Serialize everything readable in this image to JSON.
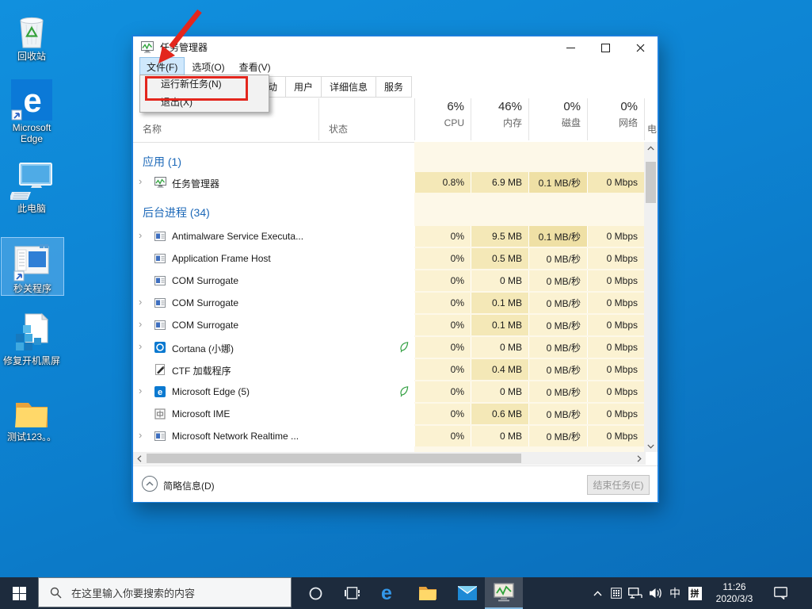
{
  "desktop": {
    "icons": [
      {
        "label": "回收站",
        "kind": "recycle-bin",
        "selected": false
      },
      {
        "label": "Microsoft Edge",
        "kind": "edge-shortcut",
        "selected": false
      },
      {
        "label": "此电脑",
        "kind": "this-pc",
        "selected": false
      },
      {
        "label": "秒关程序",
        "kind": "app-shortcut",
        "selected": true
      },
      {
        "label": "修复开机黑屏",
        "kind": "registry-file",
        "selected": false
      },
      {
        "label": "测试123。。",
        "kind": "folder",
        "selected": false
      }
    ]
  },
  "taskmgr": {
    "title": "任务管理器",
    "menubar": [
      "文件(F)",
      "选项(O)",
      "查看(V)"
    ],
    "file_menu": [
      "运行新任务(N)",
      "退出(X)"
    ],
    "tabs": [
      "启动",
      "用户",
      "详细信息",
      "服务"
    ],
    "columns": {
      "name": "名称",
      "status": "状态",
      "cpu": {
        "pct": "6%",
        "label": "CPU"
      },
      "mem": {
        "pct": "46%",
        "label": "内存"
      },
      "disk": {
        "pct": "0%",
        "label": "磁盘"
      },
      "net": {
        "pct": "0%",
        "label": "网络"
      },
      "partial": "电"
    },
    "rows": [
      {
        "type": "group",
        "label": "应用 (1)"
      },
      {
        "type": "proc",
        "name": "任务管理器",
        "icon": "taskmgr",
        "arrow": true,
        "leaf": false,
        "cpu": "0.8%",
        "mem": "6.9 MB",
        "disk": "0.1 MB/秒",
        "net": "0 Mbps",
        "heat": [
          2,
          2,
          3,
          2
        ]
      },
      {
        "type": "group",
        "label": "后台进程 (34)"
      },
      {
        "type": "proc",
        "name": "Antimalware Service Executa...",
        "icon": "app",
        "arrow": true,
        "leaf": false,
        "cpu": "0%",
        "mem": "9.5 MB",
        "disk": "0.1 MB/秒",
        "net": "0 Mbps",
        "heat": [
          1,
          2,
          3,
          1
        ]
      },
      {
        "type": "proc",
        "name": "Application Frame Host",
        "icon": "app",
        "arrow": false,
        "leaf": false,
        "cpu": "0%",
        "mem": "0.5 MB",
        "disk": "0 MB/秒",
        "net": "0 Mbps",
        "heat": [
          1,
          2,
          1,
          1
        ]
      },
      {
        "type": "proc",
        "name": "COM Surrogate",
        "icon": "app",
        "arrow": false,
        "leaf": false,
        "cpu": "0%",
        "mem": "0 MB",
        "disk": "0 MB/秒",
        "net": "0 Mbps",
        "heat": [
          1,
          1,
          1,
          1
        ]
      },
      {
        "type": "proc",
        "name": "COM Surrogate",
        "icon": "app",
        "arrow": true,
        "leaf": false,
        "cpu": "0%",
        "mem": "0.1 MB",
        "disk": "0 MB/秒",
        "net": "0 Mbps",
        "heat": [
          1,
          2,
          1,
          1
        ]
      },
      {
        "type": "proc",
        "name": "COM Surrogate",
        "icon": "app",
        "arrow": true,
        "leaf": false,
        "cpu": "0%",
        "mem": "0.1 MB",
        "disk": "0 MB/秒",
        "net": "0 Mbps",
        "heat": [
          1,
          2,
          1,
          1
        ]
      },
      {
        "type": "proc",
        "name": "Cortana (小娜)",
        "icon": "cortana",
        "arrow": true,
        "leaf": true,
        "cpu": "0%",
        "mem": "0 MB",
        "disk": "0 MB/秒",
        "net": "0 Mbps",
        "heat": [
          1,
          1,
          1,
          1
        ]
      },
      {
        "type": "proc",
        "name": "CTF 加载程序",
        "icon": "ctf",
        "arrow": false,
        "leaf": false,
        "cpu": "0%",
        "mem": "0.4 MB",
        "disk": "0 MB/秒",
        "net": "0 Mbps",
        "heat": [
          1,
          2,
          1,
          1
        ]
      },
      {
        "type": "proc",
        "name": "Microsoft Edge (5)",
        "icon": "edge",
        "arrow": true,
        "leaf": true,
        "cpu": "0%",
        "mem": "0 MB",
        "disk": "0 MB/秒",
        "net": "0 Mbps",
        "heat": [
          1,
          1,
          1,
          1
        ]
      },
      {
        "type": "proc",
        "name": "Microsoft IME",
        "icon": "ime",
        "arrow": false,
        "leaf": false,
        "cpu": "0%",
        "mem": "0.6 MB",
        "disk": "0 MB/秒",
        "net": "0 Mbps",
        "heat": [
          1,
          2,
          1,
          1
        ]
      },
      {
        "type": "proc",
        "name": "Microsoft Network Realtime ...",
        "icon": "app",
        "arrow": true,
        "leaf": false,
        "cpu": "0%",
        "mem": "0 MB",
        "disk": "0 MB/秒",
        "net": "0 Mbps",
        "heat": [
          1,
          1,
          1,
          1
        ]
      }
    ],
    "footer": {
      "details": "简略信息(D)",
      "end_task": "结束任务(E)"
    }
  },
  "taskbar": {
    "search_placeholder": "在这里输入你要搜索的内容",
    "ime_main": "中",
    "ime_box": "拼",
    "time": "11:26",
    "date": "2020/3/3"
  },
  "colors": {
    "desktop_bg": "#0d82d1",
    "taskbar_bg": "#1d2b3d",
    "annotation_red": "#e3261d",
    "accent_blue": "#0b79d7",
    "group_text_blue": "#1c68b8",
    "leaf_green": "#2f9e3f",
    "heat_levels": [
      "#fdf8e8",
      "#fbf2d2",
      "#f4e8b7",
      "#efe0a5"
    ]
  }
}
